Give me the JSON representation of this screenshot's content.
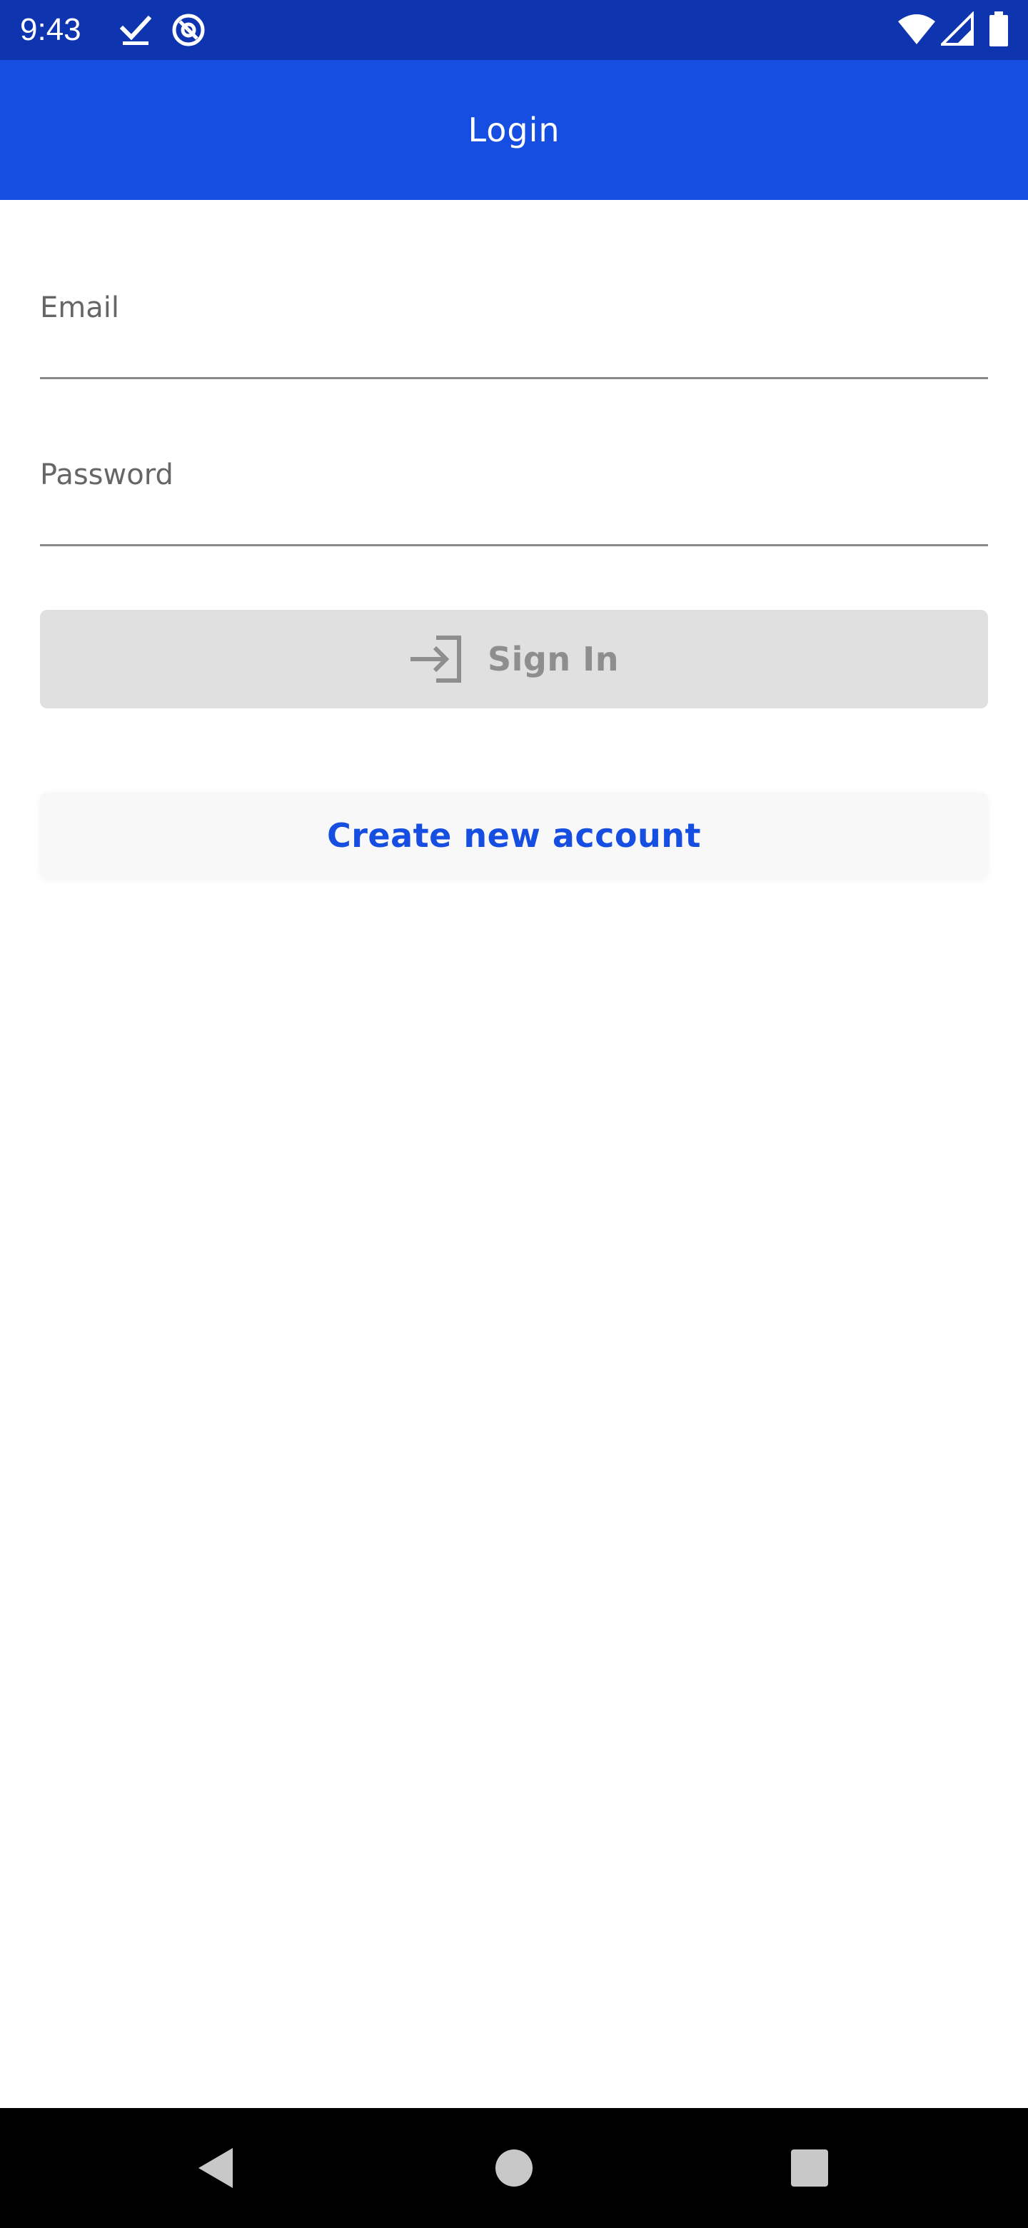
{
  "status_bar": {
    "time": "9:43",
    "icons": [
      "check-icon",
      "at-sign-icon",
      "wifi-icon",
      "signal-icon",
      "battery-icon"
    ]
  },
  "app_bar": {
    "title": "Login"
  },
  "form": {
    "email": {
      "label": "Email",
      "value": ""
    },
    "password": {
      "label": "Password",
      "value": ""
    },
    "signin": {
      "label": "Sign In",
      "icon": "login-icon"
    },
    "create_account": {
      "label": "Create new account"
    }
  },
  "nav_bar": {
    "icons": [
      "back-icon",
      "home-icon",
      "recents-icon"
    ]
  },
  "colors": {
    "status_bar": "#0e34b0",
    "app_bar": "#164ee2",
    "accent": "#164ee2",
    "button_disabled_bg": "#e0e0e0",
    "button_disabled_text": "#8e8e8e"
  }
}
